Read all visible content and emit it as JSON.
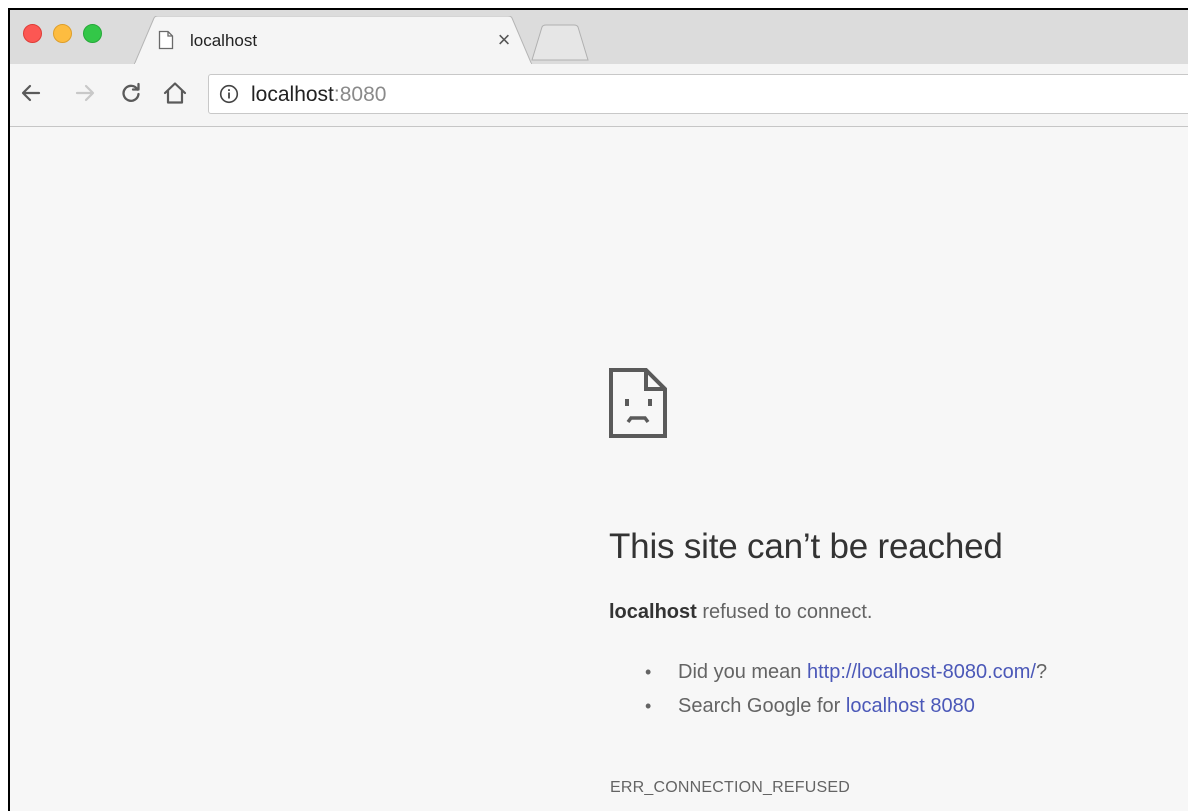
{
  "browser": {
    "tab": {
      "title": "localhost",
      "close_symbol": "×",
      "icon": "document-icon"
    },
    "new_tab": {
      "icon": "new-tab-icon"
    },
    "toolbar": {
      "back_icon": "back-arrow-icon",
      "forward_icon": "forward-arrow-icon",
      "reload_icon": "reload-icon",
      "home_icon": "home-icon"
    },
    "address_bar": {
      "host": "localhost",
      "port": ":8080",
      "info_icon": "info-icon"
    },
    "colors": {
      "close": "#fc5753",
      "minimize": "#fdbc40",
      "maximize": "#33c748",
      "link": "#4b58b8"
    }
  },
  "error_page": {
    "icon": "sad-document-icon",
    "title": "This site can’t be reached",
    "description_host": "localhost",
    "description_rest": " refused to connect.",
    "suggestions": [
      {
        "prefix": "Did you mean ",
        "link": "http://localhost-8080.com/",
        "suffix": "?"
      },
      {
        "prefix": "Search Google for ",
        "link": "localhost 8080",
        "suffix": ""
      }
    ],
    "error_code": "ERR_CONNECTION_REFUSED"
  }
}
